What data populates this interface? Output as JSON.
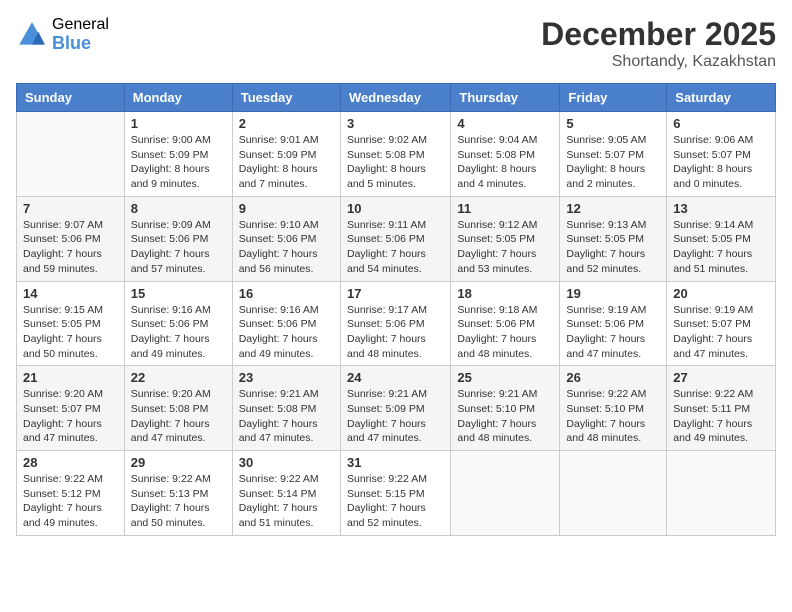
{
  "header": {
    "logo_general": "General",
    "logo_blue": "Blue",
    "month_year": "December 2025",
    "location": "Shortandy, Kazakhstan"
  },
  "days_of_week": [
    "Sunday",
    "Monday",
    "Tuesday",
    "Wednesday",
    "Thursday",
    "Friday",
    "Saturday"
  ],
  "weeks": [
    [
      {
        "day": "",
        "sunrise": "",
        "sunset": "",
        "daylight": ""
      },
      {
        "day": "1",
        "sunrise": "Sunrise: 9:00 AM",
        "sunset": "Sunset: 5:09 PM",
        "daylight": "Daylight: 8 hours and 9 minutes."
      },
      {
        "day": "2",
        "sunrise": "Sunrise: 9:01 AM",
        "sunset": "Sunset: 5:09 PM",
        "daylight": "Daylight: 8 hours and 7 minutes."
      },
      {
        "day": "3",
        "sunrise": "Sunrise: 9:02 AM",
        "sunset": "Sunset: 5:08 PM",
        "daylight": "Daylight: 8 hours and 5 minutes."
      },
      {
        "day": "4",
        "sunrise": "Sunrise: 9:04 AM",
        "sunset": "Sunset: 5:08 PM",
        "daylight": "Daylight: 8 hours and 4 minutes."
      },
      {
        "day": "5",
        "sunrise": "Sunrise: 9:05 AM",
        "sunset": "Sunset: 5:07 PM",
        "daylight": "Daylight: 8 hours and 2 minutes."
      },
      {
        "day": "6",
        "sunrise": "Sunrise: 9:06 AM",
        "sunset": "Sunset: 5:07 PM",
        "daylight": "Daylight: 8 hours and 0 minutes."
      }
    ],
    [
      {
        "day": "7",
        "sunrise": "Sunrise: 9:07 AM",
        "sunset": "Sunset: 5:06 PM",
        "daylight": "Daylight: 7 hours and 59 minutes."
      },
      {
        "day": "8",
        "sunrise": "Sunrise: 9:09 AM",
        "sunset": "Sunset: 5:06 PM",
        "daylight": "Daylight: 7 hours and 57 minutes."
      },
      {
        "day": "9",
        "sunrise": "Sunrise: 9:10 AM",
        "sunset": "Sunset: 5:06 PM",
        "daylight": "Daylight: 7 hours and 56 minutes."
      },
      {
        "day": "10",
        "sunrise": "Sunrise: 9:11 AM",
        "sunset": "Sunset: 5:06 PM",
        "daylight": "Daylight: 7 hours and 54 minutes."
      },
      {
        "day": "11",
        "sunrise": "Sunrise: 9:12 AM",
        "sunset": "Sunset: 5:05 PM",
        "daylight": "Daylight: 7 hours and 53 minutes."
      },
      {
        "day": "12",
        "sunrise": "Sunrise: 9:13 AM",
        "sunset": "Sunset: 5:05 PM",
        "daylight": "Daylight: 7 hours and 52 minutes."
      },
      {
        "day": "13",
        "sunrise": "Sunrise: 9:14 AM",
        "sunset": "Sunset: 5:05 PM",
        "daylight": "Daylight: 7 hours and 51 minutes."
      }
    ],
    [
      {
        "day": "14",
        "sunrise": "Sunrise: 9:15 AM",
        "sunset": "Sunset: 5:05 PM",
        "daylight": "Daylight: 7 hours and 50 minutes."
      },
      {
        "day": "15",
        "sunrise": "Sunrise: 9:16 AM",
        "sunset": "Sunset: 5:06 PM",
        "daylight": "Daylight: 7 hours and 49 minutes."
      },
      {
        "day": "16",
        "sunrise": "Sunrise: 9:16 AM",
        "sunset": "Sunset: 5:06 PM",
        "daylight": "Daylight: 7 hours and 49 minutes."
      },
      {
        "day": "17",
        "sunrise": "Sunrise: 9:17 AM",
        "sunset": "Sunset: 5:06 PM",
        "daylight": "Daylight: 7 hours and 48 minutes."
      },
      {
        "day": "18",
        "sunrise": "Sunrise: 9:18 AM",
        "sunset": "Sunset: 5:06 PM",
        "daylight": "Daylight: 7 hours and 48 minutes."
      },
      {
        "day": "19",
        "sunrise": "Sunrise: 9:19 AM",
        "sunset": "Sunset: 5:06 PM",
        "daylight": "Daylight: 7 hours and 47 minutes."
      },
      {
        "day": "20",
        "sunrise": "Sunrise: 9:19 AM",
        "sunset": "Sunset: 5:07 PM",
        "daylight": "Daylight: 7 hours and 47 minutes."
      }
    ],
    [
      {
        "day": "21",
        "sunrise": "Sunrise: 9:20 AM",
        "sunset": "Sunset: 5:07 PM",
        "daylight": "Daylight: 7 hours and 47 minutes."
      },
      {
        "day": "22",
        "sunrise": "Sunrise: 9:20 AM",
        "sunset": "Sunset: 5:08 PM",
        "daylight": "Daylight: 7 hours and 47 minutes."
      },
      {
        "day": "23",
        "sunrise": "Sunrise: 9:21 AM",
        "sunset": "Sunset: 5:08 PM",
        "daylight": "Daylight: 7 hours and 47 minutes."
      },
      {
        "day": "24",
        "sunrise": "Sunrise: 9:21 AM",
        "sunset": "Sunset: 5:09 PM",
        "daylight": "Daylight: 7 hours and 47 minutes."
      },
      {
        "day": "25",
        "sunrise": "Sunrise: 9:21 AM",
        "sunset": "Sunset: 5:10 PM",
        "daylight": "Daylight: 7 hours and 48 minutes."
      },
      {
        "day": "26",
        "sunrise": "Sunrise: 9:22 AM",
        "sunset": "Sunset: 5:10 PM",
        "daylight": "Daylight: 7 hours and 48 minutes."
      },
      {
        "day": "27",
        "sunrise": "Sunrise: 9:22 AM",
        "sunset": "Sunset: 5:11 PM",
        "daylight": "Daylight: 7 hours and 49 minutes."
      }
    ],
    [
      {
        "day": "28",
        "sunrise": "Sunrise: 9:22 AM",
        "sunset": "Sunset: 5:12 PM",
        "daylight": "Daylight: 7 hours and 49 minutes."
      },
      {
        "day": "29",
        "sunrise": "Sunrise: 9:22 AM",
        "sunset": "Sunset: 5:13 PM",
        "daylight": "Daylight: 7 hours and 50 minutes."
      },
      {
        "day": "30",
        "sunrise": "Sunrise: 9:22 AM",
        "sunset": "Sunset: 5:14 PM",
        "daylight": "Daylight: 7 hours and 51 minutes."
      },
      {
        "day": "31",
        "sunrise": "Sunrise: 9:22 AM",
        "sunset": "Sunset: 5:15 PM",
        "daylight": "Daylight: 7 hours and 52 minutes."
      },
      {
        "day": "",
        "sunrise": "",
        "sunset": "",
        "daylight": ""
      },
      {
        "day": "",
        "sunrise": "",
        "sunset": "",
        "daylight": ""
      },
      {
        "day": "",
        "sunrise": "",
        "sunset": "",
        "daylight": ""
      }
    ]
  ]
}
